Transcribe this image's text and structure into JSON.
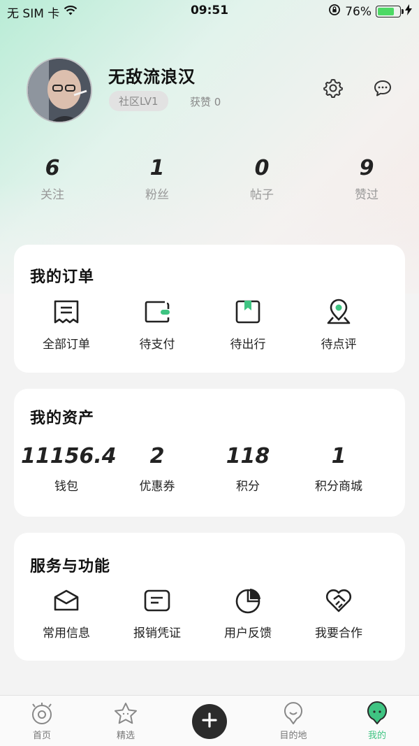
{
  "status_bar": {
    "carrier": "无 SIM 卡",
    "time": "09:51",
    "battery_percent": "76%",
    "battery_level": 0.76,
    "battery_color": "#4cd964"
  },
  "profile": {
    "username": "无敌流浪汉",
    "level": "社区LV1",
    "likes": "获赞 0"
  },
  "stats": [
    {
      "value": "6",
      "label": "关注"
    },
    {
      "value": "1",
      "label": "粉丝"
    },
    {
      "value": "0",
      "label": "帖子"
    },
    {
      "value": "9",
      "label": "赞过"
    }
  ],
  "orders": {
    "title": "我的订单",
    "items": [
      {
        "label": "全部订单",
        "icon": "receipt-icon"
      },
      {
        "label": "待支付",
        "icon": "wallet-icon"
      },
      {
        "label": "待出行",
        "icon": "bookmark-icon"
      },
      {
        "label": "待点评",
        "icon": "location-pin-icon"
      }
    ]
  },
  "assets": {
    "title": "我的资产",
    "items": [
      {
        "value": "11156.4",
        "label": "钱包"
      },
      {
        "value": "2",
        "label": "优惠券"
      },
      {
        "value": "118",
        "label": "积分"
      },
      {
        "value": "1",
        "label": "积分商城"
      }
    ]
  },
  "services": {
    "title": "服务与功能",
    "items": [
      {
        "label": "常用信息",
        "icon": "envelope-icon"
      },
      {
        "label": "报销凭证",
        "icon": "voucher-icon"
      },
      {
        "label": "用户反馈",
        "icon": "pie-chart-icon"
      },
      {
        "label": "我要合作",
        "icon": "handshake-heart-icon"
      }
    ]
  },
  "tabbar": {
    "accent": "#3fc482",
    "items": [
      {
        "label": "首页",
        "icon": "eye-icon"
      },
      {
        "label": "精选",
        "icon": "star-icon"
      },
      {
        "label": "",
        "icon": "plus-icon"
      },
      {
        "label": "目的地",
        "icon": "smile-pin-icon"
      },
      {
        "label": "我的",
        "icon": "profile-face-icon"
      }
    ],
    "active": "我的"
  }
}
